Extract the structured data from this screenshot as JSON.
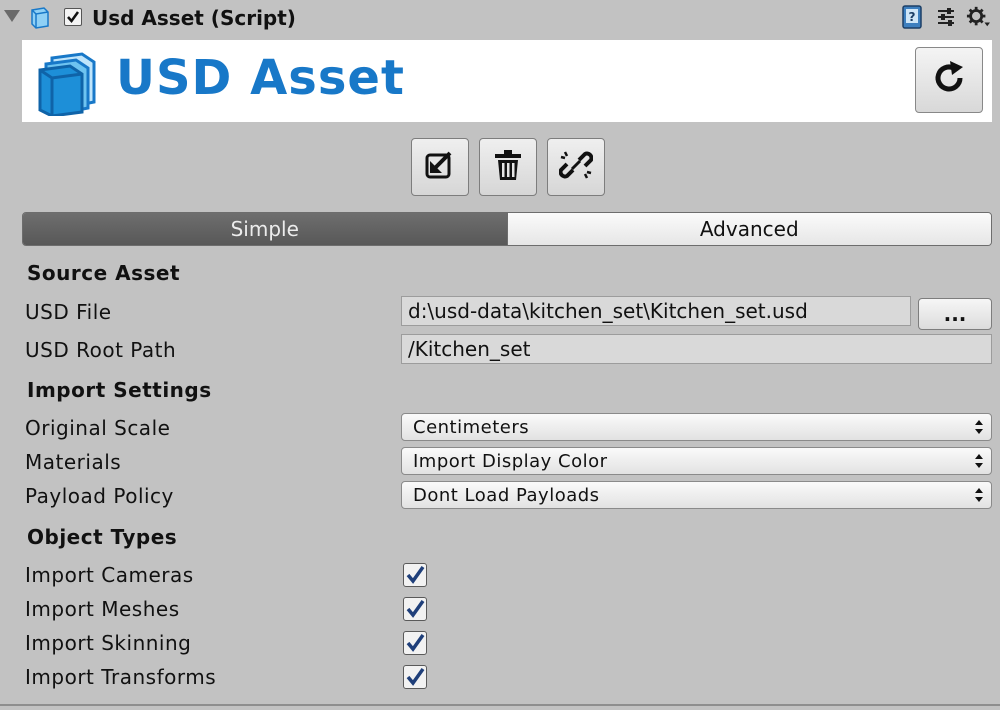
{
  "header": {
    "title": "Usd Asset (Script)",
    "icons": [
      "fold-triangle-icon",
      "usd-cube-icon",
      "enabled-checkbox",
      "help-book-icon",
      "presets-sliders-icon",
      "gear-icon"
    ]
  },
  "banner": {
    "title": "USD Asset",
    "logo": "usd-logo-icon",
    "refresh_icon": "refresh-icon"
  },
  "toolbar": {
    "icons": [
      "reimport-icon",
      "trash-icon",
      "unlink-icon"
    ]
  },
  "tabs": {
    "items": [
      {
        "label": "Simple",
        "active": true
      },
      {
        "label": "Advanced",
        "active": false
      }
    ]
  },
  "source": {
    "heading": "Source Asset",
    "usd_file_label": "USD File",
    "usd_file_value": "d:\\usd-data\\kitchen_set\\Kitchen_set.usd",
    "browse_label": "...",
    "root_path_label": "USD Root Path",
    "root_path_value": "/Kitchen_set"
  },
  "import": {
    "heading": "Import Settings",
    "scale_label": "Original Scale",
    "scale_value": "Centimeters",
    "materials_label": "Materials",
    "materials_value": "Import Display Color",
    "payload_label": "Payload Policy",
    "payload_value": "Dont Load Payloads"
  },
  "object_types": {
    "heading": "Object Types",
    "items": [
      {
        "label": "Import Cameras",
        "checked": true
      },
      {
        "label": "Import Meshes",
        "checked": true
      },
      {
        "label": "Import Skinning",
        "checked": true
      },
      {
        "label": "Import Transforms",
        "checked": true
      }
    ]
  },
  "colors": {
    "panel_bg": "#c2c2c2",
    "accent_blue": "#1878c8",
    "active_tab": "#5e5e5e"
  }
}
